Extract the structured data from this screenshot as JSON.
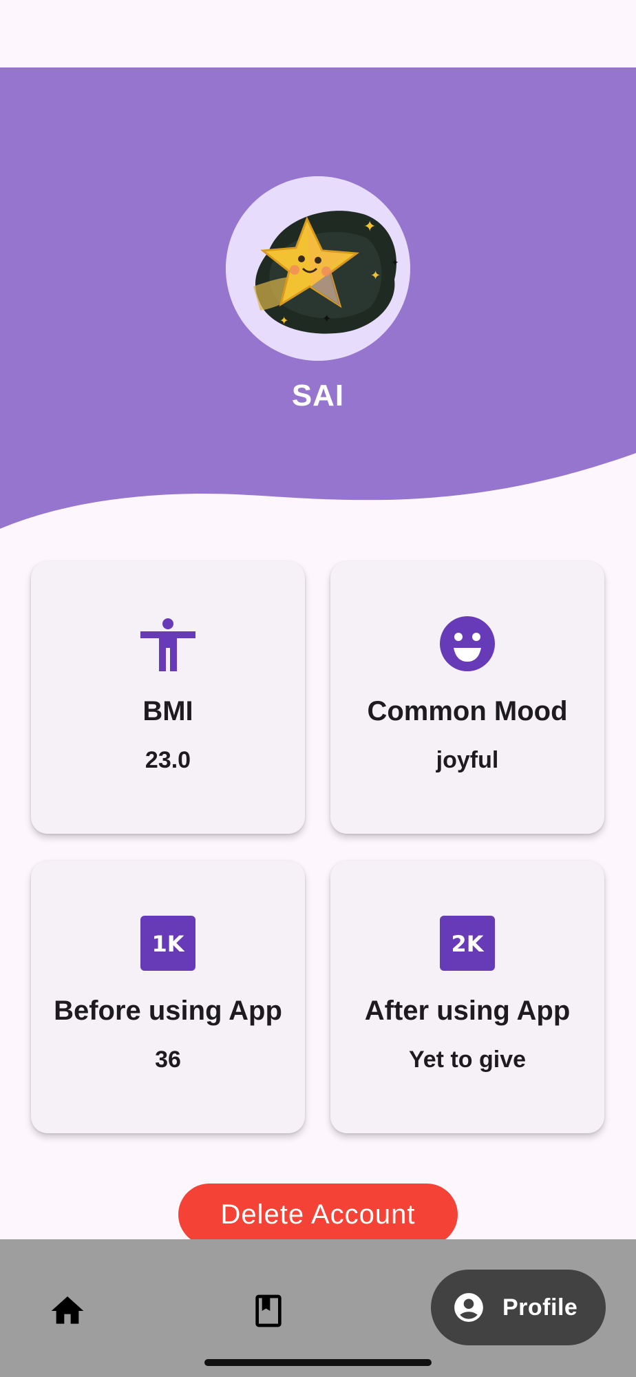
{
  "profile": {
    "name": "SAI",
    "avatar_icon": "star-avatar"
  },
  "colors": {
    "header": "#9575cd",
    "accent": "#673ab7",
    "danger": "#f44336",
    "nav_bg": "#9e9e9e",
    "nav_active": "#424242"
  },
  "cards": {
    "bmi": {
      "icon": "accessibility-icon",
      "title": "BMI",
      "value": "23.0"
    },
    "mood": {
      "icon": "smile-icon",
      "title": "Common Mood",
      "value": "joyful"
    },
    "before": {
      "icon": "1k-icon",
      "title": "Before using App",
      "value": "36"
    },
    "after": {
      "icon": "2k-icon",
      "title": "After using App",
      "value": "Yet to give"
    }
  },
  "actions": {
    "delete_label": "Delete Account"
  },
  "nav": {
    "items": [
      {
        "icon": "home-icon",
        "label": ""
      },
      {
        "icon": "book-icon",
        "label": ""
      },
      {
        "icon": "account-circle-icon",
        "label": "Profile"
      }
    ],
    "active": "Profile"
  }
}
